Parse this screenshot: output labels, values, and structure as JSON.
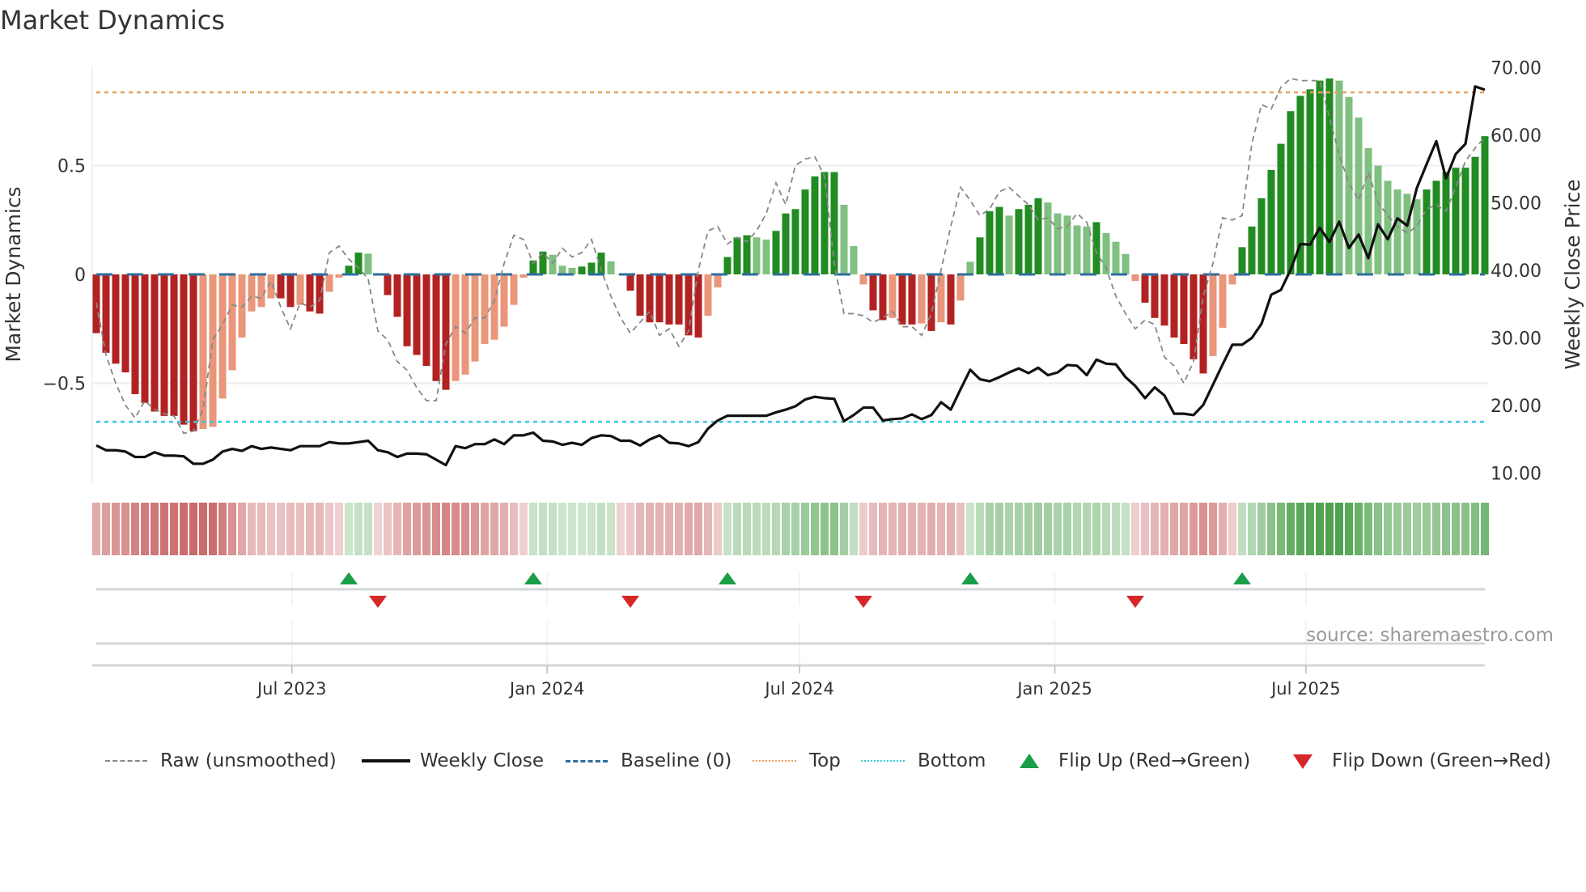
{
  "title": "Market Dynamics",
  "source": "source: sharemaestro.com",
  "colors": {
    "bar_red_strong": "#b22222",
    "bar_red_weak": "#e9967a",
    "bar_green_strong": "#228b22",
    "bar_green_weak": "#80c080",
    "close": "#111111",
    "raw": "#888888",
    "baseline": "#2e6e9e",
    "top": "#e8a060",
    "bottom": "#3cc8d8",
    "flip_up": "#1a9e48",
    "flip_down": "#d62728"
  },
  "legend": [
    {
      "key": "raw",
      "label": "Raw (unsmoothed)"
    },
    {
      "key": "close",
      "label": "Weekly Close"
    },
    {
      "key": "baseline",
      "label": "Baseline (0)"
    },
    {
      "key": "top",
      "label": "Top"
    },
    {
      "key": "bottom",
      "label": "Bottom"
    },
    {
      "key": "flip_up",
      "label": "Flip Up (Red→Green)"
    },
    {
      "key": "flip_down",
      "label": "Flip Down (Green→Red)"
    }
  ],
  "chart_data": {
    "type": "bar",
    "title": "Market Dynamics",
    "ylabel": "Market Dynamics",
    "y2label": "Weekly Close Price",
    "x_start": "2023-02-10",
    "x_frequency": "weekly",
    "ylim": [
      -0.96,
      0.96
    ],
    "y2lim": [
      8.8,
      71.0
    ],
    "yticks": [
      {
        "v": 0.5,
        "label": "0.5"
      },
      {
        "v": 0,
        "label": "0"
      },
      {
        "v": -0.5,
        "label": "−0.5"
      }
    ],
    "y2ticks": [
      {
        "v": 70,
        "label": "70.00"
      },
      {
        "v": 60,
        "label": "60.00"
      },
      {
        "v": 50,
        "label": "50.00"
      },
      {
        "v": 40,
        "label": "40.00"
      },
      {
        "v": 30,
        "label": "30.00"
      },
      {
        "v": 20,
        "label": "20.00"
      },
      {
        "v": 10,
        "label": "10.00"
      }
    ],
    "xticks": [
      {
        "date": "2023-07-01",
        "label": "Jul 2023"
      },
      {
        "date": "2024-01-01",
        "label": "Jan 2024"
      },
      {
        "date": "2024-07-01",
        "label": "Jul 2024"
      },
      {
        "date": "2025-01-01",
        "label": "Jan 2025"
      },
      {
        "date": "2025-07-01",
        "label": "Jul 2025"
      }
    ],
    "grid": true,
    "legend_position": "bottom",
    "top_level": 0.836,
    "bottom_level": -0.677,
    "baseline": 0,
    "series": [
      {
        "name": "Market Dynamics",
        "type": "bar",
        "values": [
          -0.27,
          -0.36,
          -0.41,
          -0.45,
          -0.55,
          -0.59,
          -0.63,
          -0.65,
          -0.65,
          -0.69,
          -0.72,
          -0.71,
          -0.7,
          -0.57,
          -0.44,
          -0.29,
          -0.17,
          -0.15,
          -0.11,
          -0.11,
          -0.15,
          -0.14,
          -0.17,
          -0.18,
          -0.08,
          -0.015,
          0.04,
          0.1,
          0.095,
          -0.005,
          -0.095,
          -0.195,
          -0.33,
          -0.37,
          -0.42,
          -0.49,
          -0.53,
          -0.49,
          -0.46,
          -0.4,
          -0.32,
          -0.3,
          -0.24,
          -0.14,
          -0.015,
          0.064,
          0.105,
          0.09,
          0.04,
          0.03,
          0.036,
          0.054,
          0.1,
          0.06,
          -0.003,
          -0.075,
          -0.19,
          -0.22,
          -0.22,
          -0.23,
          -0.23,
          -0.28,
          -0.29,
          -0.19,
          -0.06,
          0.08,
          0.17,
          0.18,
          0.17,
          0.16,
          0.2,
          0.28,
          0.3,
          0.39,
          0.45,
          0.47,
          0.47,
          0.32,
          0.13,
          -0.046,
          -0.165,
          -0.21,
          -0.2,
          -0.23,
          -0.23,
          -0.225,
          -0.26,
          -0.22,
          -0.23,
          -0.12,
          0.058,
          0.17,
          0.29,
          0.31,
          0.27,
          0.3,
          0.32,
          0.35,
          0.33,
          0.28,
          0.27,
          0.225,
          0.22,
          0.24,
          0.19,
          0.15,
          0.094,
          -0.03,
          -0.13,
          -0.2,
          -0.235,
          -0.29,
          -0.32,
          -0.39,
          -0.455,
          -0.375,
          -0.245,
          -0.046,
          0.125,
          0.22,
          0.35,
          0.48,
          0.6,
          0.75,
          0.82,
          0.85,
          0.89,
          0.9,
          0.89,
          0.815,
          0.72,
          0.58,
          0.5,
          0.43,
          0.39,
          0.37,
          0.345,
          0.39,
          0.43,
          0.47,
          0.49,
          0.49,
          0.54,
          0.635
        ]
      },
      {
        "name": "Raw (unsmoothed)",
        "type": "line",
        "values": [
          -0.13,
          -0.37,
          -0.5,
          -0.6,
          -0.66,
          -0.58,
          -0.62,
          -0.64,
          -0.65,
          -0.73,
          -0.72,
          -0.62,
          -0.3,
          -0.23,
          -0.14,
          -0.15,
          -0.1,
          -0.11,
          -0.03,
          -0.15,
          -0.25,
          -0.13,
          -0.15,
          -0.12,
          0.1,
          0.13,
          0.07,
          0.03,
          -0.02,
          -0.26,
          -0.3,
          -0.4,
          -0.44,
          -0.52,
          -0.58,
          -0.58,
          -0.32,
          -0.24,
          -0.27,
          -0.2,
          -0.2,
          -0.12,
          0.05,
          0.18,
          0.16,
          0.05,
          0.1,
          0.05,
          0.12,
          0.08,
          0.1,
          0.16,
          0.02,
          -0.1,
          -0.2,
          -0.27,
          -0.22,
          -0.17,
          -0.28,
          -0.25,
          -0.33,
          -0.26,
          0.02,
          0.2,
          0.22,
          0.14,
          0.17,
          0.15,
          0.2,
          0.28,
          0.42,
          0.32,
          0.5,
          0.53,
          0.54,
          0.45,
          0.05,
          -0.18,
          -0.18,
          -0.19,
          -0.22,
          -0.2,
          -0.17,
          -0.24,
          -0.24,
          -0.28,
          -0.18,
          0.02,
          0.22,
          0.4,
          0.34,
          0.27,
          0.3,
          0.38,
          0.4,
          0.36,
          0.32,
          0.25,
          0.26,
          0.21,
          0.22,
          0.28,
          0.24,
          0.1,
          0.03,
          -0.1,
          -0.18,
          -0.25,
          -0.21,
          -0.23,
          -0.38,
          -0.42,
          -0.5,
          -0.4,
          -0.1,
          0.05,
          0.26,
          0.25,
          0.27,
          0.6,
          0.78,
          0.76,
          0.86,
          0.9,
          0.89,
          0.89,
          0.89,
          0.72,
          0.55,
          0.42,
          0.34,
          0.47,
          0.33,
          0.27,
          0.22,
          0.19,
          0.22,
          0.3,
          0.32,
          0.29,
          0.4,
          0.52,
          0.58,
          0.63
        ]
      },
      {
        "name": "Weekly Close",
        "type": "line",
        "axis": "right",
        "values": [
          14.1,
          13.4,
          13.4,
          13.2,
          12.4,
          12.4,
          13.1,
          12.6,
          12.6,
          12.5,
          11.4,
          11.4,
          12.0,
          13.2,
          13.6,
          13.3,
          14.0,
          13.6,
          13.8,
          13.6,
          13.4,
          14.0,
          14.0,
          14.0,
          14.6,
          14.4,
          14.4,
          14.6,
          14.8,
          13.4,
          13.1,
          12.4,
          12.9,
          12.9,
          12.8,
          12.0,
          11.2,
          14.0,
          13.7,
          14.3,
          14.3,
          15.0,
          14.3,
          15.6,
          15.6,
          16.0,
          14.8,
          14.7,
          14.2,
          14.5,
          14.2,
          15.2,
          15.6,
          15.5,
          14.8,
          14.8,
          14.1,
          15.0,
          15.6,
          14.5,
          14.4,
          14.0,
          14.6,
          16.6,
          17.8,
          18.5,
          18.5,
          18.5,
          18.5,
          18.5,
          19.0,
          19.4,
          19.9,
          20.9,
          21.3,
          21.1,
          21.0,
          17.7,
          18.6,
          19.7,
          19.7,
          17.8,
          18.0,
          18.1,
          18.7,
          18.0,
          18.6,
          20.5,
          19.4,
          22.4,
          25.3,
          23.9,
          23.6,
          24.2,
          24.9,
          25.5,
          24.8,
          25.6,
          24.5,
          24.9,
          26.0,
          25.9,
          24.5,
          26.8,
          26.2,
          26.1,
          24.2,
          22.9,
          21.1,
          22.7,
          21.5,
          18.8,
          18.8,
          18.6,
          20.1,
          23.1,
          26.1,
          29.0,
          29.0,
          30.0,
          32.1,
          36.4,
          37.1,
          40.1,
          43.9,
          43.8,
          46.3,
          44.2,
          47.2,
          43.3,
          45.3,
          41.8,
          46.8,
          44.6,
          47.7,
          46.6,
          52.2,
          55.7,
          59.1,
          53.6,
          57.2,
          58.7,
          67.2,
          66.7
        ]
      }
    ],
    "flip_up_dates": [
      "2023-08-11",
      "2023-12-22",
      "2024-05-10",
      "2024-11-01",
      "2025-05-16"
    ],
    "flip_down_dates": [
      "2023-09-01",
      "2024-03-01",
      "2024-08-16",
      "2025-02-28"
    ]
  }
}
